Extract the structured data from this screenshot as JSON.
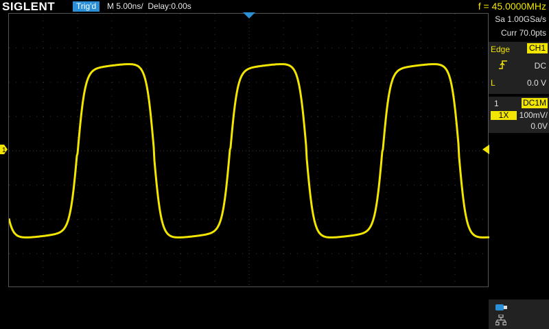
{
  "header": {
    "brand": "SIGLENT",
    "trigger_status": "Trig'd",
    "timebase": "M 5.00ns/",
    "delay": "Delay:0.00s",
    "frequency": "f = 45.0000MHz"
  },
  "acquisition": {
    "sample_rate": "Sa 1.00GSa/s",
    "record": "Curr 70.0pts"
  },
  "trigger": {
    "type_label": "Edge",
    "source": "CH1",
    "slope_icon": "rising-edge-icon",
    "coupling": "DC",
    "level_label": "L",
    "level_value": "0.0 V"
  },
  "channel": {
    "number": "1",
    "coupling": "DC1M",
    "probe": "1X",
    "scale": "100mV/",
    "offset": "0.0V",
    "color": "#f2e600",
    "marker_label": "1"
  },
  "status_icons": [
    "usb-icon",
    "network-icon"
  ],
  "colors": {
    "trace": "#f2e600",
    "accent_blue": "#2a8fd6",
    "grid": "#3a3a3a"
  },
  "waveform": {
    "frequency_hz": 45000000,
    "volts_per_div": 0.1,
    "time_per_div_ns": 5
  }
}
